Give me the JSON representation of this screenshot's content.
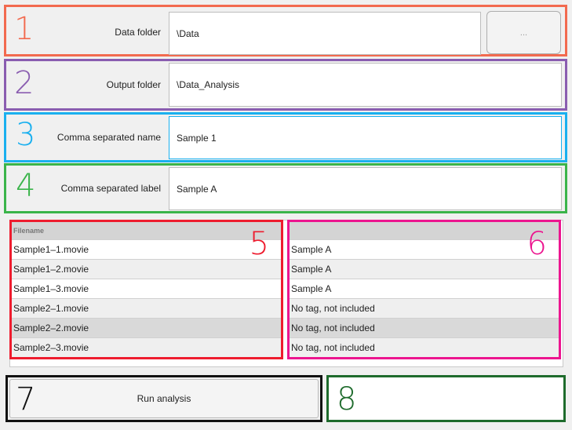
{
  "colors": {
    "panel1": "#f26a4f",
    "panel2": "#8a5db0",
    "panel3": "#1ab0ef",
    "panel4": "#3ab44a",
    "panel5": "#ee1c2e",
    "panel6": "#ec158f",
    "panel7": "#111111",
    "panel8": "#1e6b2c"
  },
  "panels": {
    "data_folder": {
      "number": "1",
      "label": "Data folder",
      "value": "\\Data",
      "browse_label": "..."
    },
    "output_folder": {
      "number": "2",
      "label": "Output folder",
      "value": "\\Data_Analysis"
    },
    "names": {
      "number": "3",
      "label": "Comma separated name",
      "value": "Sample 1"
    },
    "labels": {
      "number": "4",
      "label": "Comma separated label",
      "value": "Sample A"
    }
  },
  "table": {
    "filename_number": "5",
    "tag_number": "6",
    "columns": [
      "Filename",
      ""
    ],
    "rows": [
      {
        "filename": "Sample1–1.movie",
        "tag": "Sample A"
      },
      {
        "filename": "Sample1–2.movie",
        "tag": "Sample A"
      },
      {
        "filename": "Sample1–3.movie",
        "tag": "Sample A"
      },
      {
        "filename": "Sample2–1.movie",
        "tag": "No tag, not included"
      },
      {
        "filename": "Sample2–2.movie",
        "tag": "No tag, not included"
      },
      {
        "filename": "Sample2–3.movie",
        "tag": "No tag, not included"
      }
    ]
  },
  "run": {
    "number": "7",
    "label": "Run analysis"
  },
  "status": {
    "number": "8",
    "text": ""
  }
}
